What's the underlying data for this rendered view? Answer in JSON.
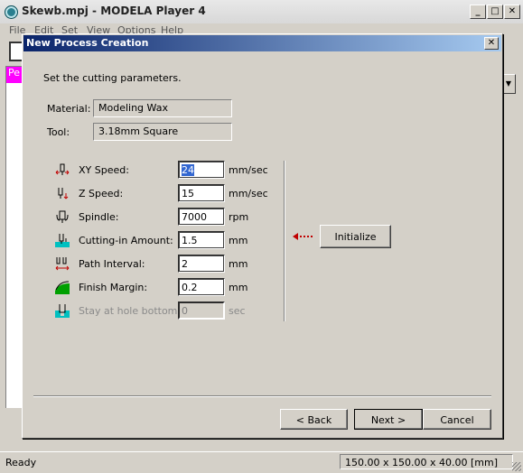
{
  "app": {
    "title": "Skewb.mpj - MODELA Player 4",
    "menu": [
      "File",
      "Edit",
      "Set",
      "View",
      "Options",
      "Help"
    ],
    "pink_tab_label": "Pe",
    "status_text": "Ready",
    "status_dims": "150.00 x 150.00 x 40.00 [mm]"
  },
  "dialog": {
    "title": "New Process Creation",
    "instruction": "Set the cutting parameters.",
    "material_label": "Material:",
    "material_value": "Modeling Wax",
    "tool_label": "Tool:",
    "tool_value": "3.18mm Square",
    "params": [
      {
        "label": "XY Speed:",
        "value": "24",
        "unit": "mm/sec",
        "icon": "xy-speed-icon"
      },
      {
        "label": "Z Speed:",
        "value": "15",
        "unit": "mm/sec",
        "icon": "z-speed-icon"
      },
      {
        "label": "Spindle:",
        "value": "7000",
        "unit": "rpm",
        "icon": "spindle-icon"
      },
      {
        "label": "Cutting-in Amount:",
        "value": "1.5",
        "unit": "mm",
        "icon": "cutting-in-icon"
      },
      {
        "label": "Path Interval:",
        "value": "2",
        "unit": "mm",
        "icon": "path-interval-icon"
      },
      {
        "label": "Finish Margin:",
        "value": "0.2",
        "unit": "mm",
        "icon": "finish-margin-icon"
      },
      {
        "label": "Stay at hole bottom:",
        "value": "0",
        "unit": "sec",
        "icon": "stay-hole-icon",
        "disabled": true
      }
    ],
    "initialize_label": "Initialize",
    "back_label": "< Back",
    "next_label": "Next >",
    "cancel_label": "Cancel"
  },
  "colors": {
    "title_bar_start": "#0a246a",
    "title_bar_end": "#a6caf0",
    "dialog_bg": "#d4d0c8",
    "accent_red": "#c00000",
    "accent_cyan": "#00c0c0",
    "accent_green": "#00a000"
  }
}
